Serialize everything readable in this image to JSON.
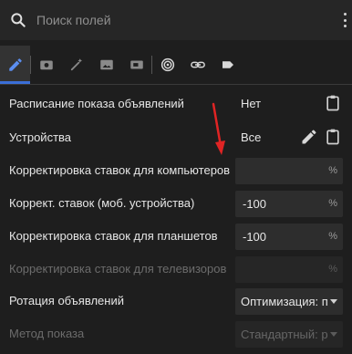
{
  "search": {
    "placeholder": "Поиск полей"
  },
  "tabs": [
    {
      "icon": "pencil-icon",
      "active": true
    },
    {
      "icon": "camera-icon",
      "active": false
    },
    {
      "icon": "magic-wand-icon",
      "active": false
    },
    {
      "icon": "image-icon",
      "active": false
    },
    {
      "icon": "video-icon",
      "active": false
    },
    {
      "icon": "target-icon",
      "active": false
    },
    {
      "icon": "link-icon",
      "active": false
    },
    {
      "icon": "label-icon",
      "active": false
    }
  ],
  "rows": {
    "schedule": {
      "label": "Расписание показа объявлений",
      "value": "Нет"
    },
    "devices": {
      "label": "Устройства",
      "value": "Все"
    },
    "desktop_bid": {
      "label": "Корректировка ставок для компьютеров",
      "value": "",
      "suffix": "%"
    },
    "mobile_bid": {
      "label": "Коррект. ставок (моб. устройства)",
      "value": "-100",
      "suffix": "%"
    },
    "tablet_bid": {
      "label": "Корректировка ставок для планшетов",
      "value": "-100",
      "suffix": "%"
    },
    "tv_bid": {
      "label": "Корректировка ставок для телевизоров",
      "value": "",
      "suffix": "%"
    },
    "ad_rotation": {
      "label": "Ротация объявлений",
      "value": "Оптимизация: п"
    },
    "delivery_method": {
      "label": "Метод показа",
      "value": "Стандартный: р"
    }
  },
  "colors": {
    "accent": "#3b6fd8",
    "annotation_arrow": "#e02424"
  }
}
